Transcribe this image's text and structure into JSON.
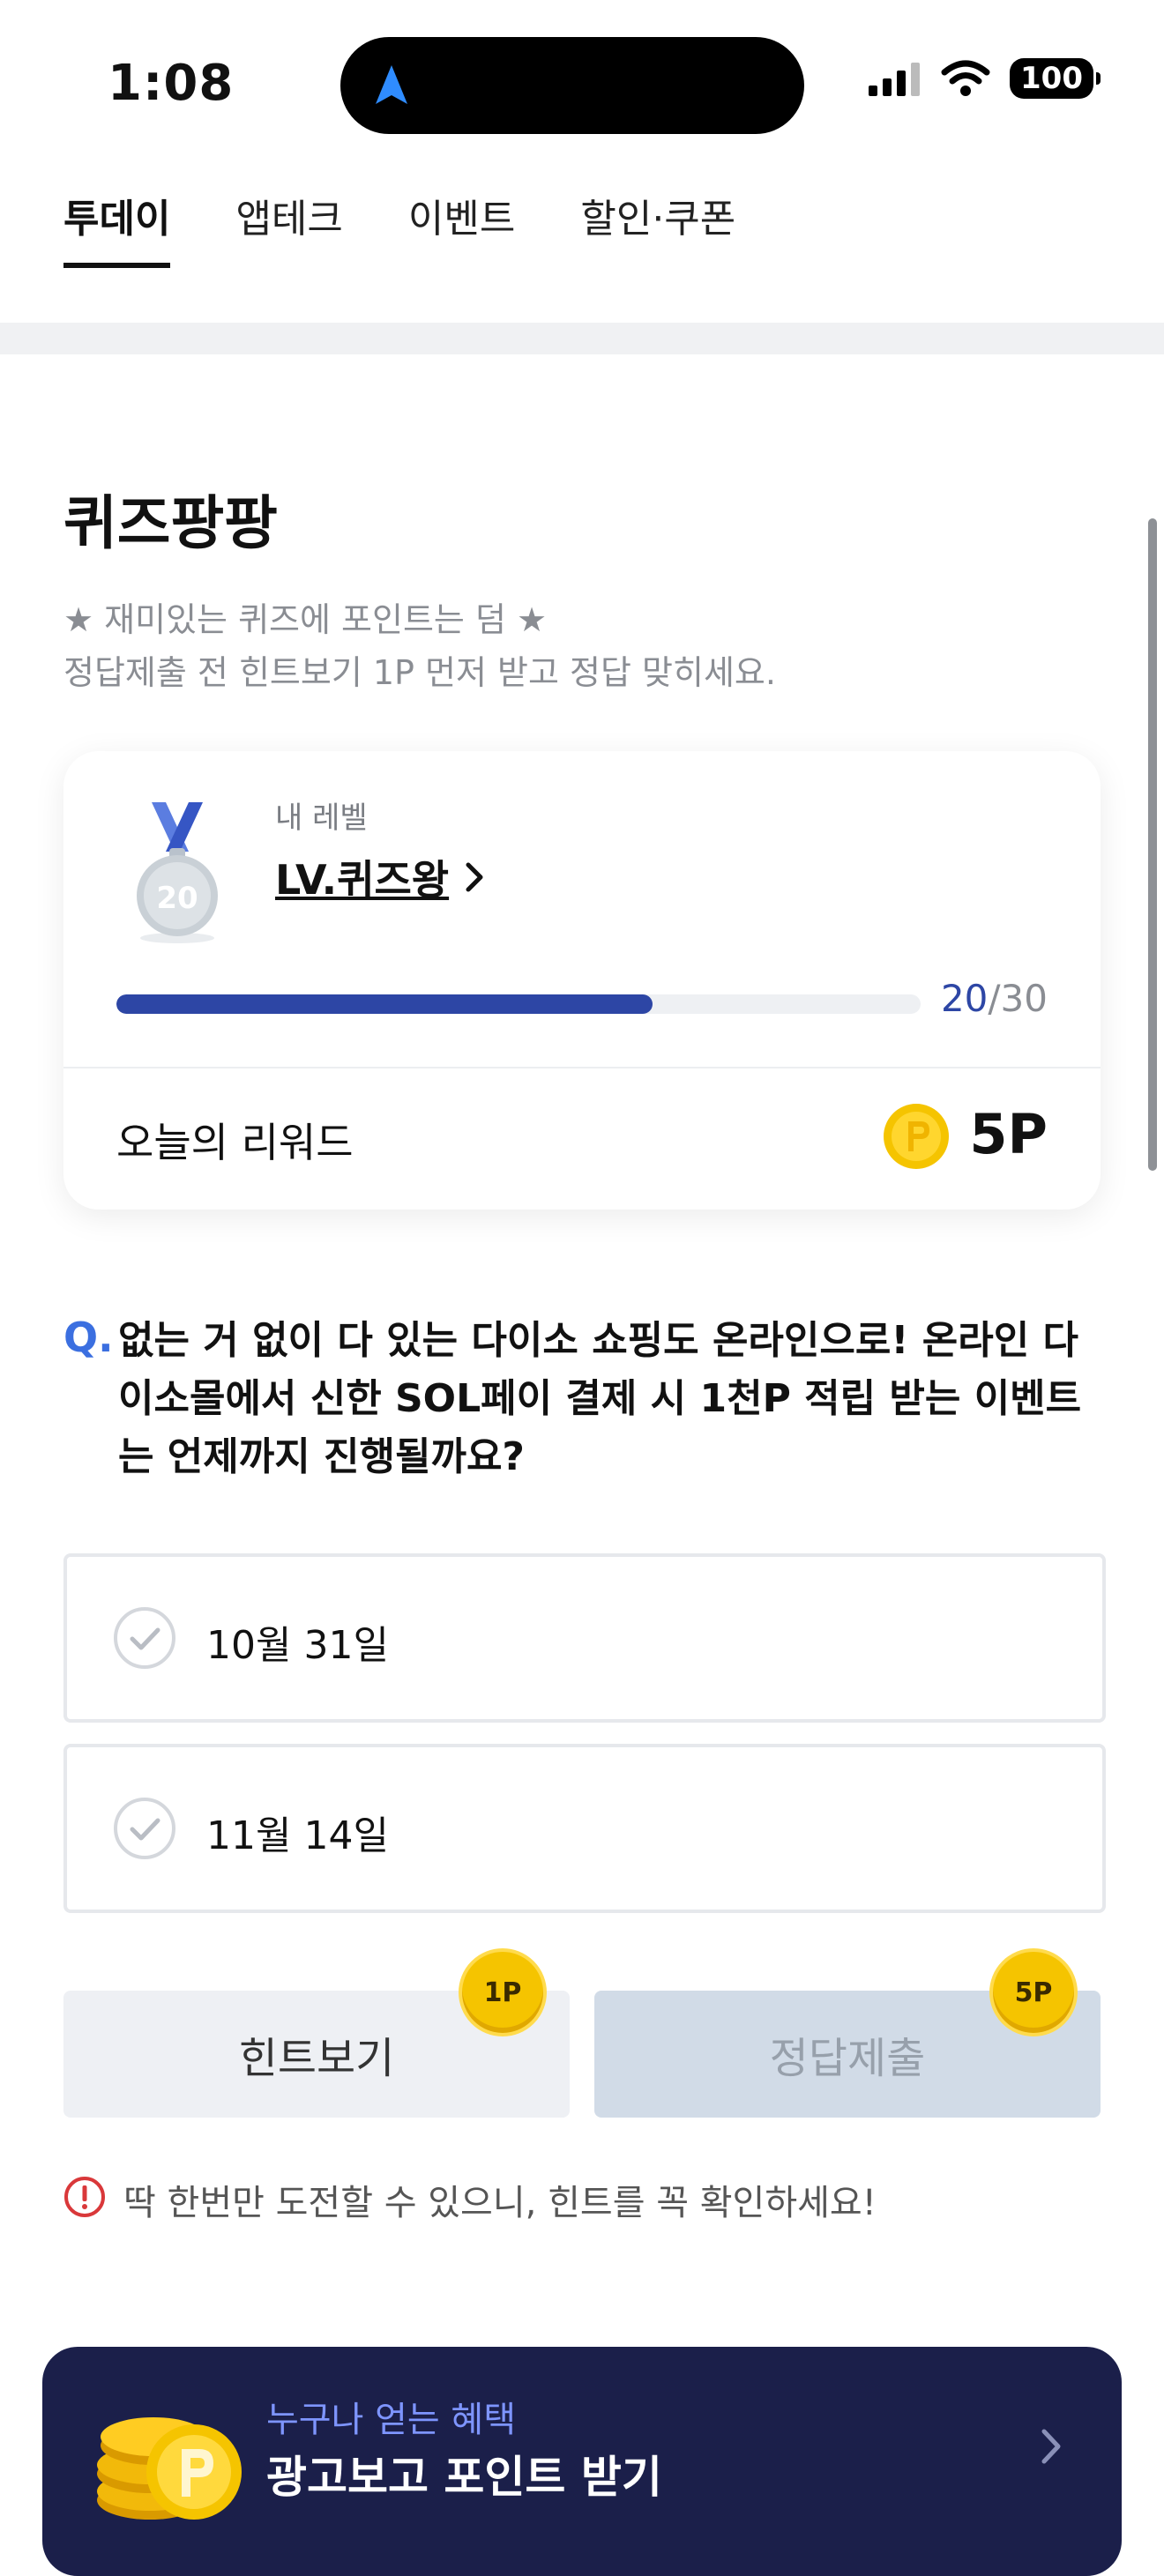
{
  "status_bar": {
    "time": "1:08",
    "battery": "100"
  },
  "tabs": [
    {
      "label": "투데이",
      "active": true
    },
    {
      "label": "앱테크",
      "active": false
    },
    {
      "label": "이벤트",
      "active": false
    },
    {
      "label": "할인·쿠폰",
      "active": false
    }
  ],
  "section": {
    "title": "퀴즈팡팡",
    "subtitle_line1": "★ 재미있는 퀴즈에 포인트는 덤 ★",
    "subtitle_line2": "정답제출 전 힌트보기 1P 먼저 받고 정답 맞히세요."
  },
  "level_card": {
    "medal_number": "20",
    "label": "내 레벨",
    "level_name": "LV.퀴즈왕",
    "progress_current": "20",
    "progress_separator": "/",
    "progress_total": "30",
    "progress_fraction": 0.667,
    "reward_label": "오늘의 리워드",
    "reward_value": "5P"
  },
  "quiz": {
    "q_prefix": "Q.",
    "question": "없는 거 없이 다 있는 다이소 쇼핑도 온라인으로! 온라인 다이소몰에서 신한 SOL페이 결제 시 1천P 적립 받는 이벤트는 언제까지 진행될까요?",
    "options": [
      {
        "label": "10월 31일"
      },
      {
        "label": "11월 14일"
      }
    ]
  },
  "buttons": {
    "hint_label": "힌트보기",
    "hint_badge": "1P",
    "submit_label": "정답제출",
    "submit_badge": "5P"
  },
  "notice": "딱 한번만 도전할 수 있으니, 힌트를 꼭 확인하세요!",
  "banner": {
    "subtitle": "누구나 얻는 혜택",
    "title": "광고보고 포인트 받기"
  },
  "colors": {
    "accent_blue": "#2d46a5",
    "question_blue": "#3b6fe0",
    "coin_gold": "#f5c400",
    "banner_bg": "#1b1f4a",
    "warning_red": "#d9383a"
  }
}
